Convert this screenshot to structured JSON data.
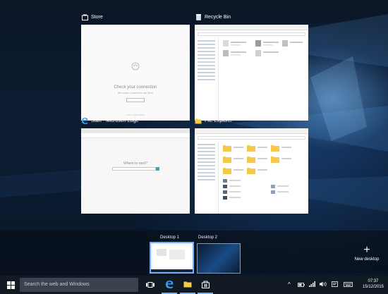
{
  "windows": {
    "store": {
      "title": "Store",
      "message": "Check your connection",
      "subtext": "We couldn't connect to the Store",
      "retry_label": "Retry",
      "footer": "Code: 0x80072EFD"
    },
    "recycle_bin": {
      "title": "Recycle Bin"
    },
    "edge": {
      "title": "Start - Microsoft Edge",
      "prompt": "Where to next?"
    },
    "file_explorer": {
      "title": "File Explorer"
    }
  },
  "desktops": [
    {
      "label": "Desktop 1",
      "active": true
    },
    {
      "label": "Desktop 2",
      "active": false
    }
  ],
  "new_desktop": {
    "label": "New desktop"
  },
  "taskbar": {
    "search_placeholder": "Search the web and Windows",
    "time": "07:37",
    "date": "15/12/2015"
  },
  "colors": {
    "accent": "#2b79d8",
    "taskbar": "#111923",
    "highlight": "#6fb3ff"
  }
}
